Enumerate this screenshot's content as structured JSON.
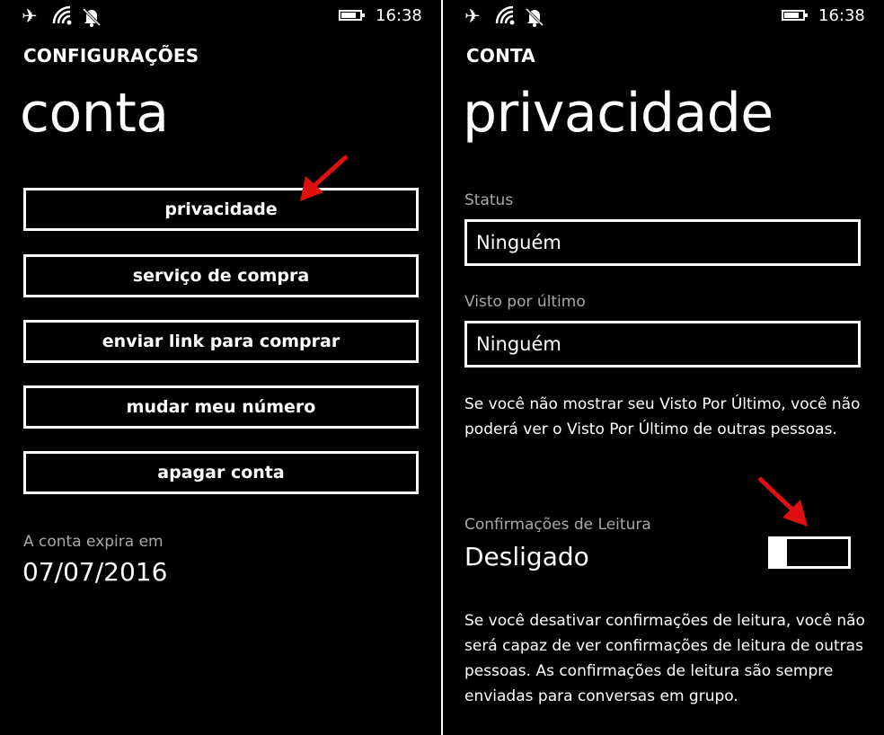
{
  "status_bar": {
    "time": "16:38",
    "battery_level": 0.8
  },
  "left": {
    "section_title": "CONFIGURAÇÕES",
    "page_title": "conta",
    "buttons": [
      {
        "label": "privacidade"
      },
      {
        "label": "serviço de compra"
      },
      {
        "label": "enviar link para comprar"
      },
      {
        "label": "mudar meu número"
      },
      {
        "label": "apagar conta"
      }
    ],
    "expire_label": "A conta expira em",
    "expire_date": "07/07/2016"
  },
  "right": {
    "section_title": "CONTA",
    "page_title": "privacidade",
    "status_label": "Status",
    "status_value": "Ninguém",
    "last_seen_label": "Visto por último",
    "last_seen_value": "Ninguém",
    "last_seen_note": "Se você não mostrar seu Visto Por Último, você não poderá ver o Visto Por Último de outras pessoas.",
    "read_receipts_label": "Confirmações de Leitura",
    "read_receipts_state": "Desligado",
    "read_receipts_on": false,
    "read_receipts_note": "Se você desativar confirmações de leitura, você não será capaz de ver confirmações de leitura de outras pessoas. As confirmações de leitura são sempre enviadas para conversas em grupo."
  },
  "colors": {
    "background": "#000000",
    "foreground": "#ffffff",
    "muted": "#a8a8a8",
    "arrow": "#e01010"
  },
  "icons": [
    "airplane-icon",
    "wifi-icon",
    "bell-off-icon",
    "battery-icon",
    "red-arrow-icon"
  ]
}
